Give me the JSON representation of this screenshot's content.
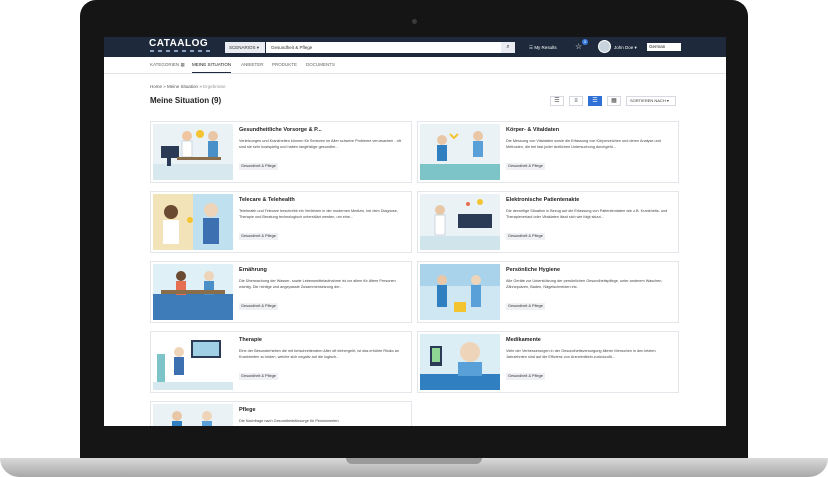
{
  "header": {
    "logo": "CATAALOG",
    "scenario_dropdown": "SCENARIOS",
    "search_value": "Gesundheit & Pflege",
    "my_results": "My Results",
    "star_count": "0",
    "user_name": "John Doe",
    "language": "German"
  },
  "icons": {
    "search": "search-icon",
    "results": "list-icon",
    "star": "star-icon",
    "avatar": "user-avatar",
    "views": [
      "list-view-icon",
      "compact-list-icon",
      "card-list-icon",
      "grid-view-icon"
    ]
  },
  "subnav": {
    "items": [
      "KATEGORIEN",
      "MEINE SITUATION",
      "ANBIETER",
      "PRODUKTE",
      "DOCUMENTS"
    ],
    "active": "MEINE SITUATION"
  },
  "breadcrumb": {
    "home": "Home",
    "situation": "Meine Situation",
    "results": "Ergebnisse"
  },
  "page": {
    "title": "Meine Situation (9)",
    "sort_label": "SORTIEREN NACH"
  },
  "colors": {
    "topbar": "#1e2a3c",
    "accent": "#2f6fd6"
  },
  "cards": [
    {
      "title": "Gesundheitliche Vorsorge & P...",
      "desc": "Verletzungen und Krankheiten können für Senioren im Alter schwere Probleme verursachen - oft sind sie sehr kostspielig und haben langfristige gesundhe...",
      "tag": "Gesundheit & Pflege"
    },
    {
      "title": "Körper- & Vitaldaten",
      "desc": "Die Messung von Vitaldaten sowie die Erfassung von Körperzeichen und deren Analyse und Methoden, die bei fast jeder ärztlichen Untersuchung durchgefü...",
      "tag": "Gesundheit & Pflege"
    },
    {
      "title": "Telecare & Telehealth",
      "desc": "Telehealth und Telecare beschreibt ein Verfahren in der modernen Medizin, bei dem Diagnose, Therapie und Beratung technologisch unterstützt werden, um eine...",
      "tag": "Gesundheit & Pflege"
    },
    {
      "title": "Elektronische Patientenakte",
      "desc": "Die derzeitige Situation in Bezug auf die Erfassung von Patientendaten wie z.B. Krankheits- und Therapieverlauf oder Vitaldaten lässt sich wie folgt skizzi...",
      "tag": "Gesundheit & Pflege"
    },
    {
      "title": "Ernährung",
      "desc": "Die Überwachung der Wasser- sowie Lebensmittelaufnahme ist vor allem für ältere Personen wichtig. Die richtige und angepasste Zusammensetzung der...",
      "tag": "Gesundheit & Pflege"
    },
    {
      "title": "Persönliche Hygiene",
      "desc": "Alle Geräte zur Unterstützung der persönlichen Gesundheitspflege, unter anderem Waschen, Zähneputzen, Baden, Nägelschneiden etc.",
      "tag": "Gesundheit & Pflege"
    },
    {
      "title": "Therapie",
      "desc": "Eine der Besonderheiten die mit fortschreitendem Alter oft einhergeht, ist das erhöhte Risiko an Krankheiten zu leiden, welche sich negativ auf die Iogisch...",
      "tag": "Gesundheit & Pflege"
    },
    {
      "title": "Medikamente",
      "desc": "Viele der Verbesserungen in der Gesundheitsversorgung älterer Menschen in den letzten Jahrzehnten sind auf die Effizienz von Arzneimitteln zurückzufü...",
      "tag": "Gesundheit & Pflege"
    },
    {
      "title": "Pflege",
      "desc": "Die Nachfrage nach Gesundheitsfürsorge für Pensionierten",
      "tag": ""
    }
  ]
}
